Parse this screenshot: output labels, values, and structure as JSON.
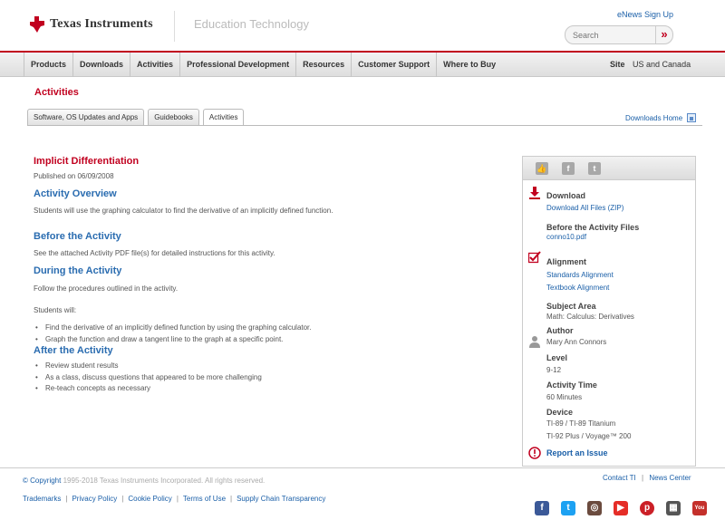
{
  "header": {
    "logo_text": "Texas Instruments",
    "section": "Education Technology",
    "enews_link": "eNews Sign Up",
    "search_placeholder": "Search",
    "search_button": "»"
  },
  "nav": {
    "items": [
      "Products",
      "Downloads",
      "Activities",
      "Professional Development",
      "Resources",
      "Customer Support",
      "Where to Buy"
    ],
    "site_label": "Site",
    "site_value": "US and Canada"
  },
  "page": {
    "title": "Activities",
    "tabs": [
      "Software, OS Updates and Apps",
      "Guidebooks",
      "Activities"
    ],
    "active_tab": "Activities",
    "downloads_home": "Downloads Home"
  },
  "activity": {
    "title": "Implicit Differentiation",
    "published": "Published on 06/09/2008",
    "overview_heading": "Activity Overview",
    "overview_text": "Students will use the graphing calculator to find the derivative of an implicitly defined function.",
    "before_heading": "Before the Activity",
    "before_text": "See the attached Activity PDF file(s) for detailed instructions for this activity.",
    "during_heading": "During the Activity",
    "during_text": "Follow the procedures outlined in the activity.",
    "students_will": "Students will:",
    "during_bullets": [
      "Find the derivative of an implicitly defined function by using the graphing calculator.",
      "Graph the function and draw a tangent line to the graph at a specific point."
    ],
    "after_heading": "After the Activity",
    "after_bullets": [
      "Review student results",
      "As a class, discuss questions that appeared to be more challenging",
      "Re-teach concepts as necessary"
    ]
  },
  "sidebar": {
    "download_label": "Download",
    "download_all": "Download All Files (ZIP)",
    "before_files_label": "Before the Activity Files",
    "before_file": "conno10.pdf",
    "alignment_label": "Alignment",
    "standards_alignment": "Standards Alignment",
    "textbook_alignment": "Textbook Alignment",
    "subject_label": "Subject Area",
    "subject_value": "Math: Calculus: Derivatives",
    "author_label": "Author",
    "author_value": "Mary Ann Connors",
    "level_label": "Level",
    "level_value": "9-12",
    "time_label": "Activity Time",
    "time_value": "60 Minutes",
    "device_label": "Device",
    "device_value_1": "TI-89 / TI-89 Titanium",
    "device_value_2": "TI-92 Plus / Voyage™ 200",
    "report": "Report an Issue"
  },
  "footer": {
    "copyright_symbol": "© Copyright",
    "copyright_text": "1995-2018 Texas Instruments Incorporated. All rights reserved.",
    "contact": "Contact TI",
    "news_center": "News Center",
    "links": [
      "Trademarks",
      "Privacy Policy",
      "Cookie Policy",
      "Terms of Use",
      "Supply Chain Transparency"
    ]
  },
  "colors": {
    "brand_red": "#c1001f",
    "link_blue": "#1a5fa8",
    "heading_blue": "#2a6cb0"
  }
}
